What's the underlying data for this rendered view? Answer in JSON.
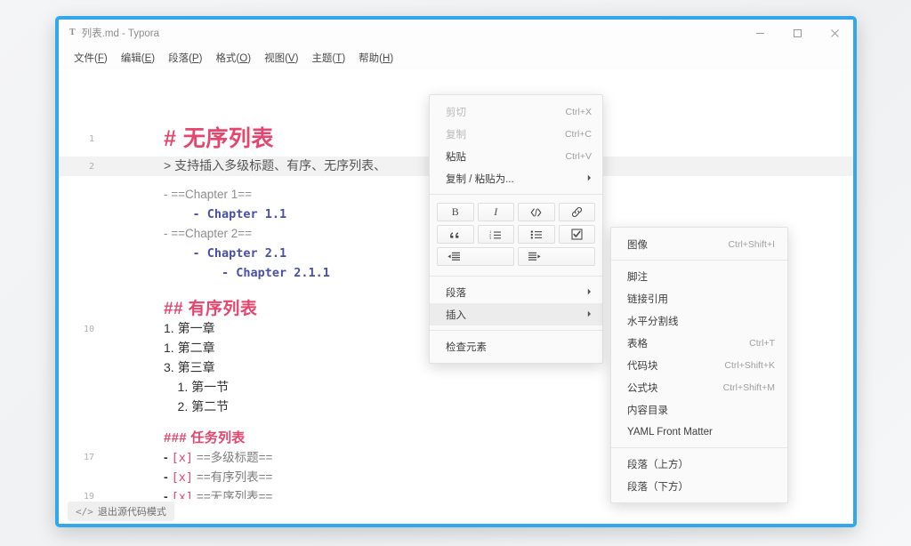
{
  "window": {
    "app_logo": "T",
    "title": "列表.md - Typora",
    "controls": {
      "minimize": "minimize-icon",
      "maximize": "maximize-icon",
      "close": "close-icon"
    }
  },
  "menubar": {
    "items": [
      {
        "label": "文件(F)",
        "text": "文件(",
        "mnemonic": "F",
        "tail": ")"
      },
      {
        "label": "编辑(E)",
        "text": "编辑(",
        "mnemonic": "E",
        "tail": ")"
      },
      {
        "label": "段落(P)",
        "text": "段落(",
        "mnemonic": "P",
        "tail": ")"
      },
      {
        "label": "格式(O)",
        "text": "格式(",
        "mnemonic": "O",
        "tail": ")"
      },
      {
        "label": "视图(V)",
        "text": "视图(",
        "mnemonic": "V",
        "tail": ")"
      },
      {
        "label": "主题(T)",
        "text": "主题(",
        "mnemonic": "T",
        "tail": ")"
      },
      {
        "label": "帮助(H)",
        "text": "帮助(",
        "mnemonic": "H",
        "tail": ")"
      }
    ]
  },
  "editor": {
    "mode": "source-code",
    "lines": [
      {
        "num": "1",
        "text": "# 无序列表",
        "style": "h1",
        "highlight": false
      },
      {
        "num": "2",
        "text": "> 支持插入多级标题、有序、无序列表、",
        "style": "quote",
        "highlight": true
      },
      {
        "num": "",
        "text": "- ==Chapter 1==",
        "style": "plain",
        "highlight": false
      },
      {
        "num": "",
        "text": "    - Chapter 1.1",
        "style": "mono",
        "highlight": false
      },
      {
        "num": "",
        "text": "- ==Chapter 2==",
        "style": "plain",
        "highlight": false
      },
      {
        "num": "",
        "text": "    - Chapter 2.1",
        "style": "mono",
        "highlight": false
      },
      {
        "num": "",
        "text": "        - Chapter 2.1.1",
        "style": "mono",
        "highlight": false
      },
      {
        "num": "",
        "text": "## 有序列表",
        "style": "h2",
        "highlight": false
      },
      {
        "num": "10",
        "text": "1. 第一章",
        "style": "list",
        "highlight": false
      },
      {
        "num": "",
        "text": "1. 第二章",
        "style": "list",
        "highlight": false
      },
      {
        "num": "",
        "text": "3. 第三章",
        "style": "list",
        "highlight": false
      },
      {
        "num": "",
        "text": "    1. 第一节",
        "style": "list",
        "highlight": false
      },
      {
        "num": "",
        "text": "    2. 第二节",
        "style": "list",
        "highlight": false
      },
      {
        "num": "",
        "text": "### 任务列表",
        "style": "h3",
        "highlight": false
      },
      {
        "num": "17",
        "text": "- [x] ==多级标题==",
        "style": "task",
        "highlight": false
      },
      {
        "num": "",
        "text": "- [x] ==有序列表==",
        "style": "task",
        "highlight": false
      },
      {
        "num": "19",
        "text": "- [x] ==无序列表==",
        "style": "task",
        "highlight": false
      }
    ]
  },
  "statusbar": {
    "source_toggle_icon": "</>",
    "source_toggle_label": "退出源代码模式"
  },
  "context_menu": {
    "items": [
      {
        "label": "剪切",
        "accel": "Ctrl+X",
        "disabled": true,
        "arrow": false
      },
      {
        "label": "复制",
        "accel": "Ctrl+C",
        "disabled": true,
        "arrow": false
      },
      {
        "label": "粘贴",
        "accel": "Ctrl+V",
        "disabled": false,
        "arrow": false
      },
      {
        "label": "复制 / 粘贴为...",
        "accel": "",
        "disabled": false,
        "arrow": true
      }
    ],
    "format_buttons": [
      {
        "name": "bold-icon",
        "glyph": "B"
      },
      {
        "name": "italic-icon",
        "glyph": "I"
      },
      {
        "name": "inline-code-icon",
        "glyph": "</>"
      },
      {
        "name": "link-icon",
        "glyph": "🔗"
      },
      {
        "name": "blockquote-icon",
        "glyph": "”"
      },
      {
        "name": "ordered-list-icon",
        "glyph": "1."
      },
      {
        "name": "bullet-list-icon",
        "glyph": "•"
      },
      {
        "name": "task-list-icon",
        "glyph": "☑"
      },
      {
        "name": "outdent-icon",
        "glyph": "⇤"
      },
      {
        "name": "indent-icon",
        "glyph": "⇥"
      }
    ],
    "lower_items": [
      {
        "label": "段落",
        "accel": "",
        "arrow": true,
        "active": false
      },
      {
        "label": "插入",
        "accel": "",
        "arrow": true,
        "active": true
      },
      {
        "label": "检查元素",
        "accel": "",
        "arrow": false,
        "active": false
      }
    ]
  },
  "submenu": {
    "groups": [
      [
        {
          "label": "图像",
          "accel": "Ctrl+Shift+I"
        }
      ],
      [
        {
          "label": "脚注",
          "accel": ""
        },
        {
          "label": "链接引用",
          "accel": ""
        },
        {
          "label": "水平分割线",
          "accel": ""
        },
        {
          "label": "表格",
          "accel": "Ctrl+T"
        },
        {
          "label": "代码块",
          "accel": "Ctrl+Shift+K"
        },
        {
          "label": "公式块",
          "accel": "Ctrl+Shift+M"
        },
        {
          "label": "内容目录",
          "accel": ""
        },
        {
          "label": "YAML Front Matter",
          "accel": ""
        }
      ],
      [
        {
          "label": "段落（上方）",
          "accel": ""
        },
        {
          "label": "段落（下方）",
          "accel": ""
        }
      ]
    ]
  },
  "colors": {
    "window_border": "#31a9e8",
    "heading": "#e4466e",
    "mono_text": "#4a4fa8",
    "menu_bg": "#fafafa",
    "highlight_row": "#ececec"
  }
}
